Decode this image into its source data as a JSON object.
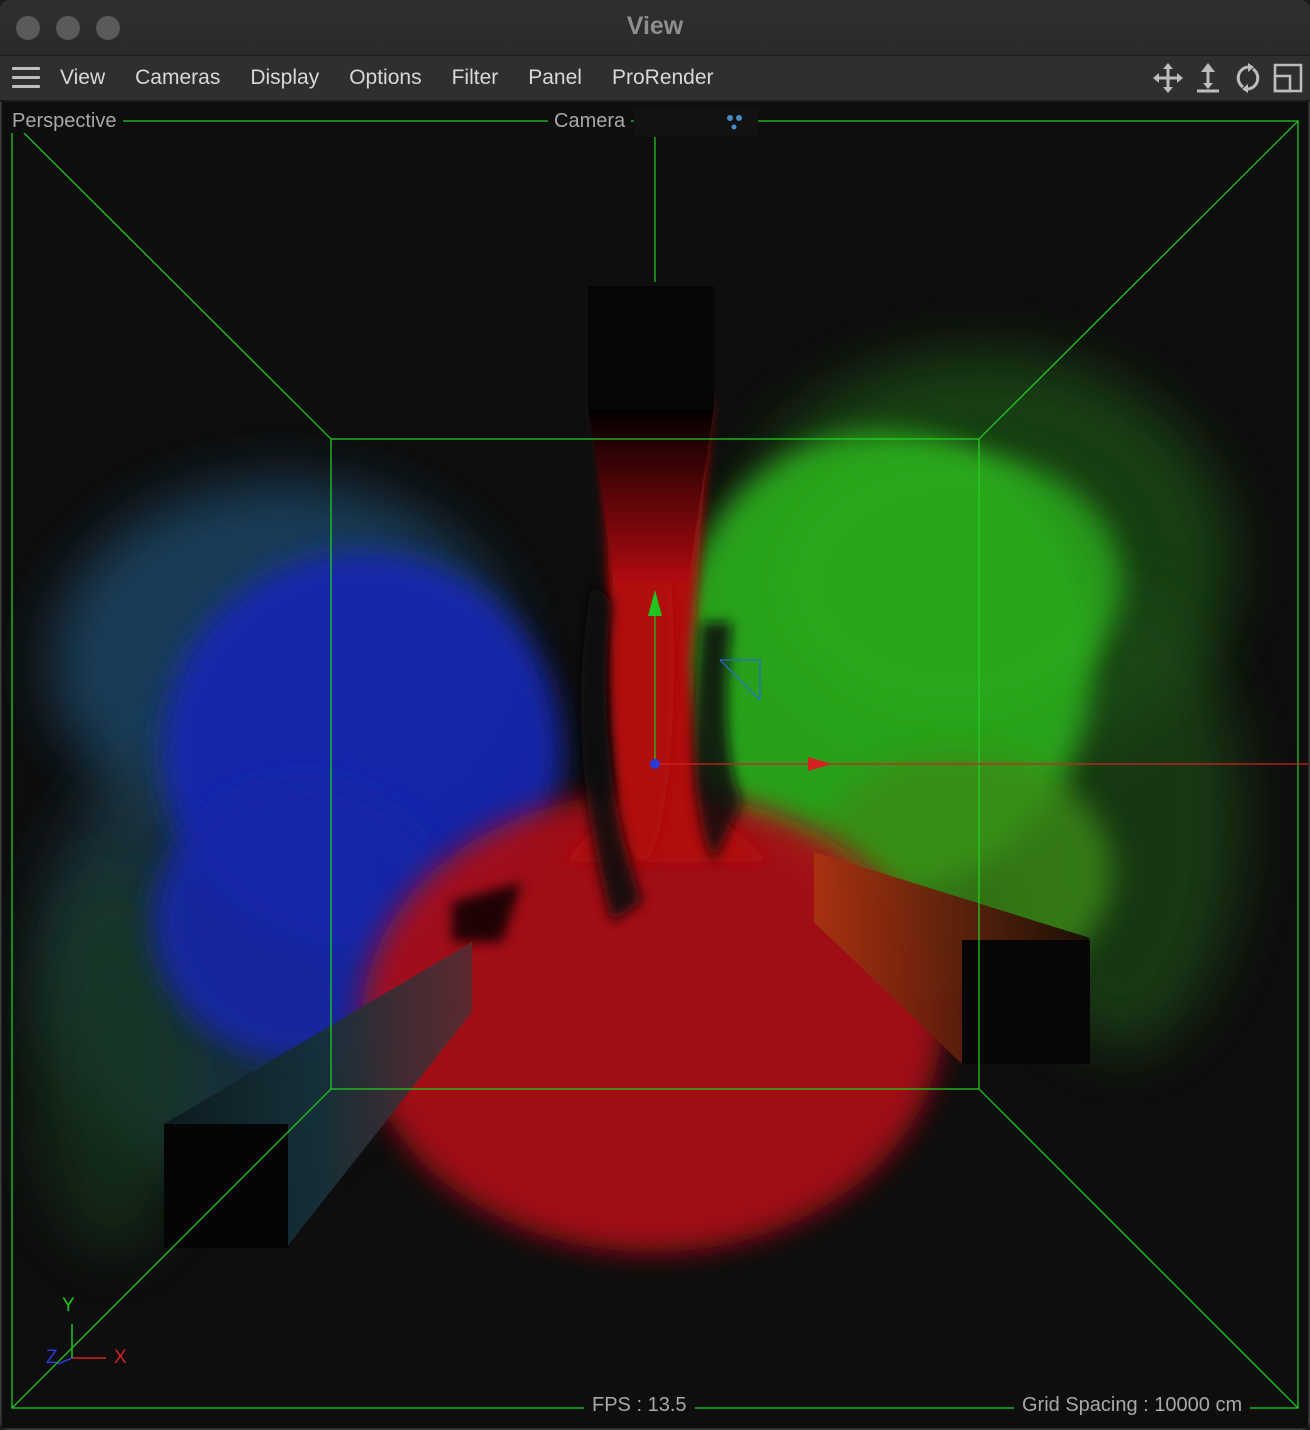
{
  "window": {
    "title": "View"
  },
  "menu": {
    "items": [
      "View",
      "Cameras",
      "Display",
      "Options",
      "Filter",
      "Panel",
      "ProRender"
    ],
    "right_icons": [
      "move-icon",
      "move-vertical-icon",
      "rotate-icon",
      "maximize-view-icon"
    ]
  },
  "viewport": {
    "projection_label": "Perspective",
    "camera_label": "Camera",
    "fps_text": "FPS : 13.5",
    "grid_spacing_text": "Grid Spacing : 10000 cm"
  },
  "axes": {
    "x": "X",
    "y": "Y",
    "z": "Z"
  },
  "colors": {
    "box_line": "#1fd51f",
    "red_smoke": "#b01015",
    "green_smoke": "#2aa81a",
    "blue_smoke": "#1426b0",
    "axis_x": "#d42020",
    "axis_y": "#1fc51f",
    "axis_z": "#2a3ad8"
  }
}
